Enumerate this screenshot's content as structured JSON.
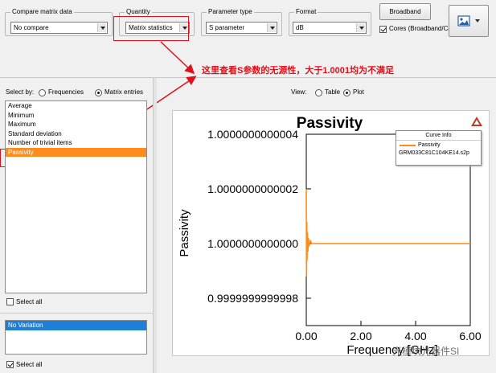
{
  "toolbar": {
    "compare": {
      "title": "Compare matrix data",
      "value": "No compare"
    },
    "quantity": {
      "title": "Quantity",
      "value": "Matrix statistics"
    },
    "parameter_type": {
      "title": "Parameter type",
      "value": "S parameter"
    },
    "format": {
      "title": "Format",
      "value": "dB"
    },
    "broadband_button": "Broadband",
    "cores_label": "Cores (Broadband/Ca",
    "cores_checked": true
  },
  "annotation": {
    "text": "这里查看S参数的无源性，大于1.0001均为不满足",
    "color": "#e0101a"
  },
  "select_by": {
    "label": "Select by:",
    "options": [
      "Frequencies",
      "Matrix entries"
    ],
    "selected": "Matrix entries"
  },
  "view": {
    "label": "View:",
    "options": [
      "Table",
      "Plot"
    ],
    "selected": "Plot"
  },
  "stats_list": {
    "items": [
      "Average",
      "Minimum",
      "Maximum",
      "Standard deviation",
      "Number of trivial items",
      "Passivity"
    ],
    "selected": "Passivity",
    "select_all_label": "Select all"
  },
  "variation_list": {
    "items": [
      "No Variation"
    ],
    "select_all_label": "Select all"
  },
  "curve_info": {
    "title": "Curve Info",
    "series_name": "Passivity",
    "file": "GRM033C81C104KE14.s2p"
  },
  "watermark": "光模块光器件SI",
  "colors": {
    "accent": "#ff8c1a",
    "annotation": "#e0101a",
    "selection_blue": "#1e7fd9"
  },
  "chart_data": {
    "type": "line",
    "title": "Passivity",
    "xlabel": "Frequency [GHz]",
    "ylabel": "Passivity",
    "xlim": [
      0,
      6
    ],
    "ylim": [
      0.9999999999997,
      1.0000000000004
    ],
    "x_ticks": [
      "0.00",
      "2.00",
      "4.00",
      "6.00"
    ],
    "y_ticks": [
      "1.0000000000004",
      "1.0000000000002",
      "1.0000000000000",
      "0.9999999999998"
    ],
    "series": [
      {
        "name": "Passivity",
        "color": "#ff8c1a",
        "x": [
          0.0,
          0.01,
          0.02,
          0.03,
          0.04,
          0.06,
          0.08,
          0.1,
          0.15,
          0.2,
          0.3,
          0.5,
          1.0,
          2.0,
          3.0,
          4.0,
          5.0,
          6.0
        ],
        "y": [
          1.0000000000002,
          0.99999999999988,
          1.00000000000008,
          0.99999999999994,
          1.00000000000004,
          0.99999999999997,
          1.00000000000002,
          0.99999999999999,
          1.00000000000001,
          1.0,
          1.0,
          1.0,
          1.0,
          1.0,
          1.0,
          1.0,
          1.0,
          1.0
        ]
      }
    ]
  }
}
